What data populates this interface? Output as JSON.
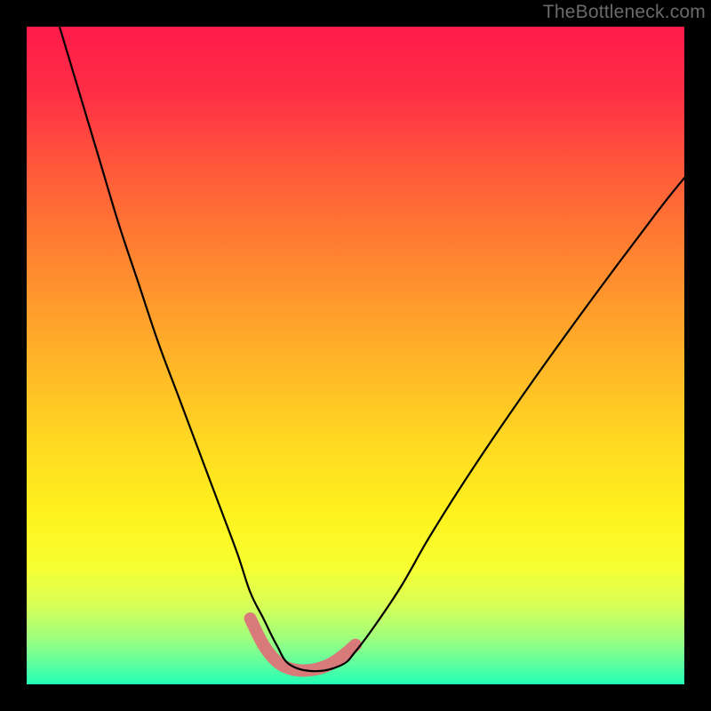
{
  "watermark": "TheBottleneck.com",
  "gradient_stops": [
    {
      "offset": 0.0,
      "color": "#ff1b4b"
    },
    {
      "offset": 0.1,
      "color": "#ff2e45"
    },
    {
      "offset": 0.22,
      "color": "#ff5a3a"
    },
    {
      "offset": 0.35,
      "color": "#ff8430"
    },
    {
      "offset": 0.5,
      "color": "#ffb228"
    },
    {
      "offset": 0.63,
      "color": "#ffd822"
    },
    {
      "offset": 0.74,
      "color": "#fff21e"
    },
    {
      "offset": 0.82,
      "color": "#f7ff30"
    },
    {
      "offset": 0.88,
      "color": "#d7ff58"
    },
    {
      "offset": 0.93,
      "color": "#9fff7e"
    },
    {
      "offset": 0.97,
      "color": "#5cffa0"
    },
    {
      "offset": 1.0,
      "color": "#22ffb4"
    }
  ],
  "chart_data": {
    "type": "line",
    "title": "",
    "xlabel": "",
    "ylabel": "",
    "xlim": [
      0,
      100
    ],
    "ylim": [
      0,
      100
    ],
    "categories_note": "x and y are in percent of plot width/height, y=0 is bottom (green), y=100 is top (red)",
    "series": [
      {
        "name": "bottleneck-curve",
        "stroke": "#000000",
        "stroke_width": 2.2,
        "x": [
          5,
          8,
          11,
          14,
          17,
          20,
          23,
          26,
          29,
          32,
          34,
          36,
          38,
          40,
          44,
          48,
          50,
          53,
          57,
          61,
          66,
          72,
          79,
          87,
          96,
          100
        ],
        "y": [
          100,
          90,
          80,
          70,
          61,
          52,
          44,
          36,
          28,
          20,
          14,
          10,
          6,
          3,
          2,
          3,
          5,
          9,
          15,
          22,
          30,
          39,
          49,
          60,
          72,
          77
        ]
      },
      {
        "name": "minimum-highlight",
        "stroke": "#d87a7a",
        "stroke_width": 14,
        "linecap": "round",
        "x": [
          34,
          36,
          38,
          40,
          42,
          44,
          46,
          48,
          50
        ],
        "y": [
          10,
          6,
          3.5,
          2.4,
          2.1,
          2.3,
          3.0,
          4.3,
          6.0
        ]
      }
    ]
  }
}
